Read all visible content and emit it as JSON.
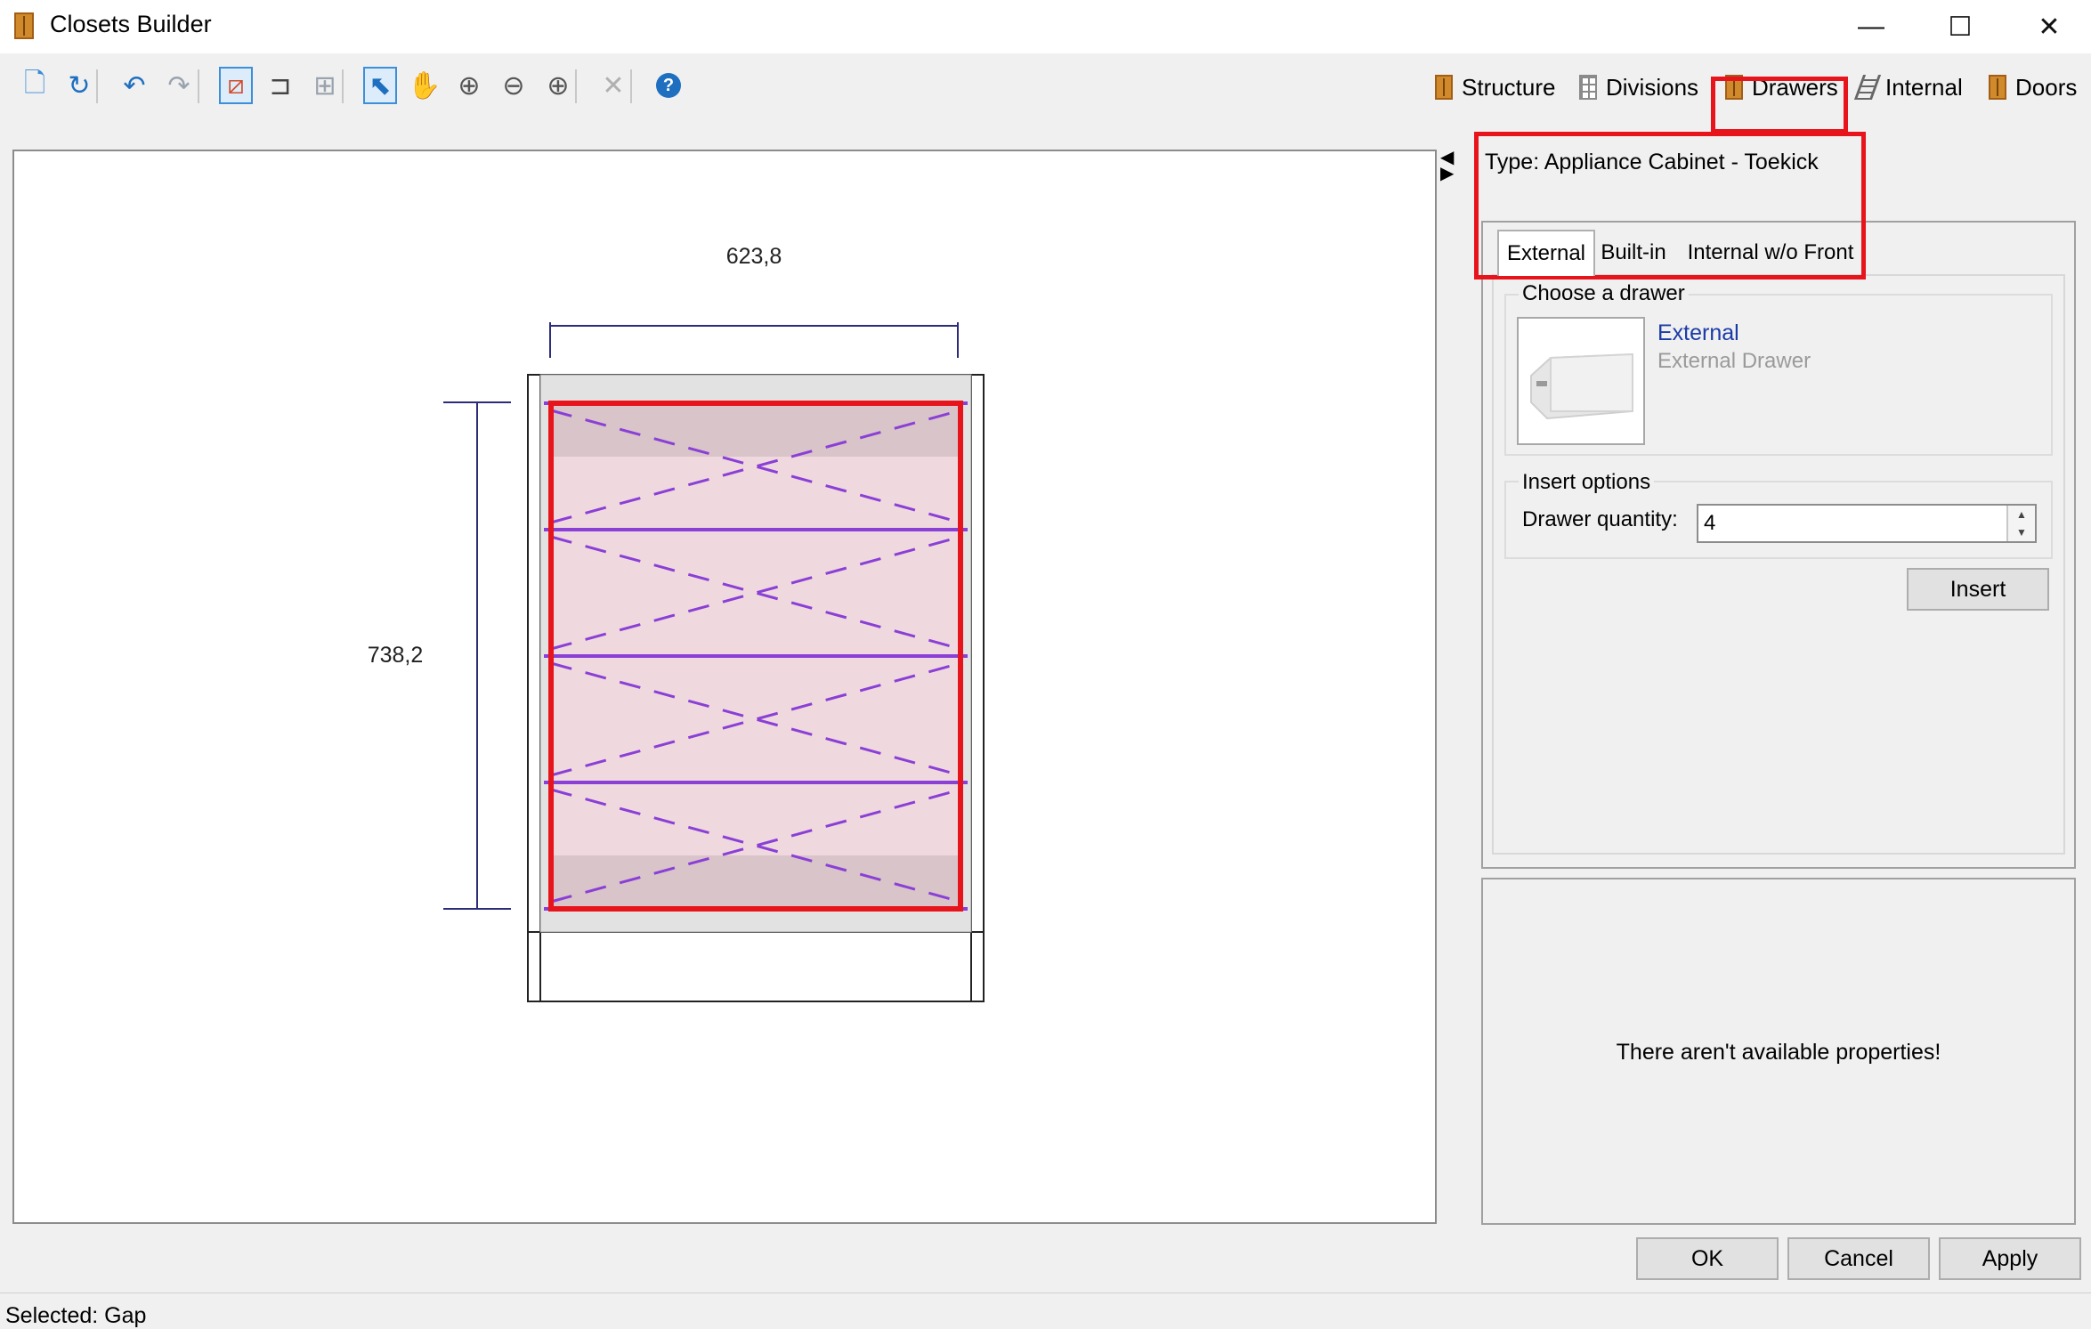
{
  "window": {
    "title": "Closets Builder",
    "minimize": "—",
    "maximize": "☐",
    "close": "✕"
  },
  "toolbar": {
    "icons": [
      "new-icon",
      "refresh-icon",
      "undo-icon",
      "redo-icon",
      "wireframe-icon",
      "bracket-icon",
      "grid-icon",
      "select-icon",
      "hand-icon",
      "zoom-fit-icon",
      "zoom-out-icon",
      "zoom-in-icon",
      "delete-icon",
      "help-icon"
    ],
    "glyphs": [
      "🗋",
      "↻",
      "↶",
      "↷",
      "⧄",
      "⊐",
      "⊞",
      "⬉",
      "✋",
      "⊕",
      "⊖",
      "⊕",
      "✕",
      "?"
    ]
  },
  "mode_tabs": [
    {
      "label": "Structure"
    },
    {
      "label": "Divisions"
    },
    {
      "label": "Drawers"
    },
    {
      "label": "Internal"
    },
    {
      "label": "Doors"
    }
  ],
  "canvas": {
    "width_dim": "623,8",
    "height_dim": "738,2",
    "accent": "#8a3fd6",
    "selection_color": "#e8141c"
  },
  "panel": {
    "type_label": "Type: Appliance Cabinet - Toekick",
    "tabs": [
      "External",
      "Built-in",
      "Internal w/o Front"
    ],
    "choose_group": "Choose a drawer",
    "drawer_name": "External",
    "drawer_desc": "External Drawer",
    "insert_group": "Insert options",
    "qty_label": "Drawer quantity:",
    "qty_value": "4",
    "insert_button": "Insert",
    "props_message": "There aren't available properties!"
  },
  "buttons": {
    "ok": "OK",
    "cancel": "Cancel",
    "apply": "Apply"
  },
  "status": {
    "text": "Selected: Gap"
  }
}
